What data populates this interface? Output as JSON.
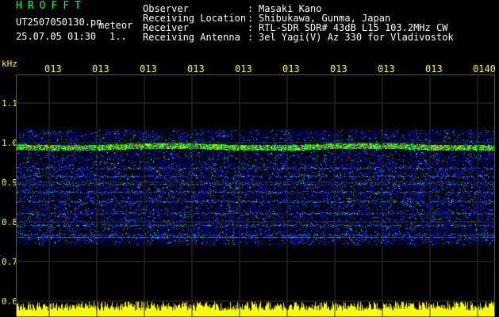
{
  "header": {
    "brand": "HROFFT",
    "file_name": "UT2507050130.pn",
    "meteor_label": "meteor",
    "timestamp": "25.07.05 01:30",
    "count": "1.."
  },
  "meta": [
    {
      "label": "Observer",
      "value": "Masaki Kano"
    },
    {
      "label": "Receiving Location",
      "value": "Shibukawa, Gunma, Japan"
    },
    {
      "label": "Receiver",
      "value": "RTL-SDR SDR# 43dB L15 103.2MHz CW"
    },
    {
      "label": "Receiving Antenna",
      "value": "3el Yagi(V) Az 330 for Vladivostok"
    }
  ],
  "axis": {
    "y_unit": "kHz",
    "x_ticks": [
      "013",
      "013",
      "013",
      "013",
      "013",
      "013",
      "013",
      "013",
      "013",
      "0140"
    ],
    "y_ticks": [
      "1.1",
      "1.0",
      "0.9",
      "0.8",
      "0.7",
      "0.6"
    ]
  },
  "colors": {
    "background": "#000000",
    "text": "#ffffff",
    "axis": "#ffff00",
    "brand": "#00ff66",
    "signal": "#0000ff",
    "grid": "#333333"
  }
}
